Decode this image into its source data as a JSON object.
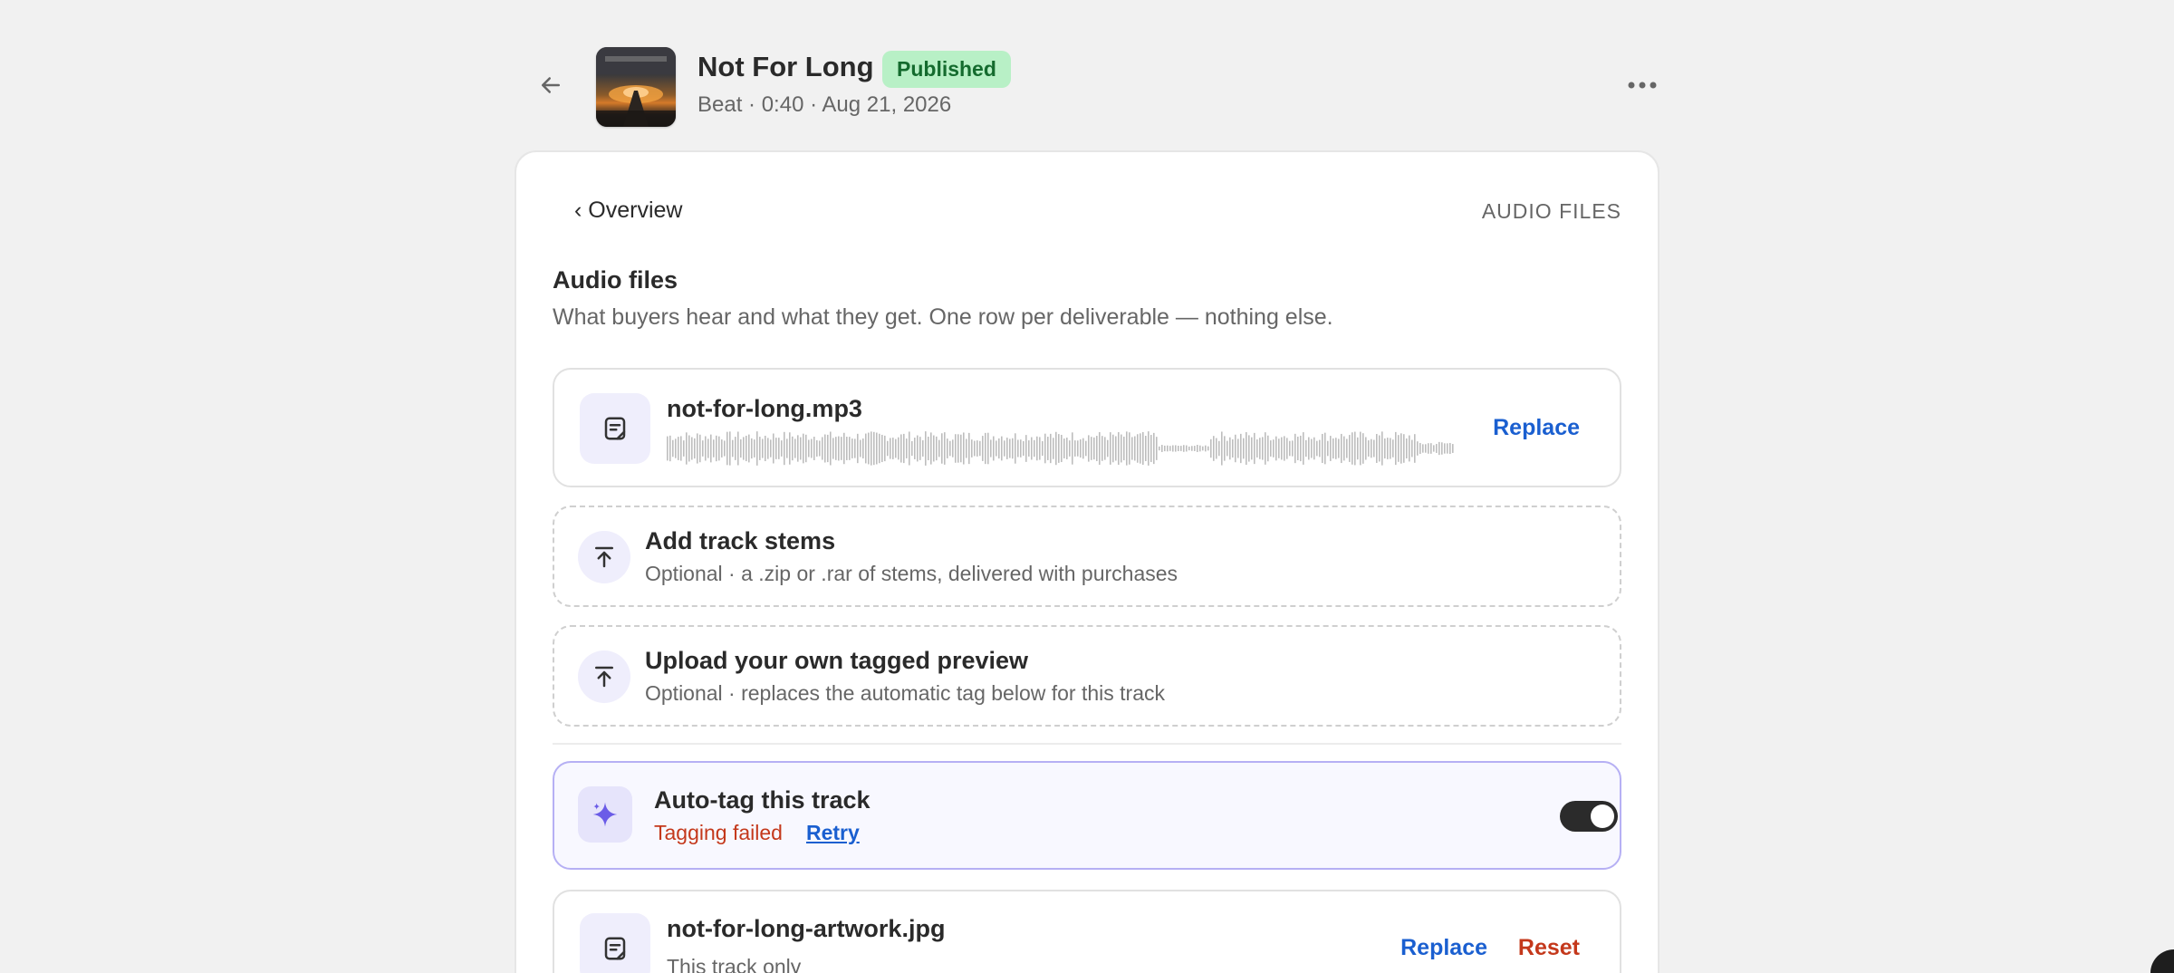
{
  "header": {
    "title": "Not For Long",
    "status_badge": "Published",
    "meta": "Beat · 0:40 · Aug 21, 2026"
  },
  "card": {
    "back_link": "‹ Overview",
    "section_tag": "AUDIO FILES",
    "title": "Audio files",
    "subtitle": "What buyers hear and what they get. One row per deliverable — nothing else."
  },
  "main_file": {
    "filename": "not-for-long.mp3",
    "replace_label": "Replace"
  },
  "stems": {
    "title": "Add track stems",
    "subtitle": "Optional · a .zip or .rar of stems, delivered with purchases"
  },
  "tagged_preview": {
    "title": "Upload your own tagged preview",
    "subtitle": "Optional · replaces the automatic tag below for this track"
  },
  "autotag": {
    "title": "Auto-tag this track",
    "status": "Tagging failed",
    "retry_label": "Retry",
    "enabled": true
  },
  "artwork_file": {
    "filename": "not-for-long-artwork.jpg",
    "subtitle": "This track only",
    "replace_label": "Replace",
    "reset_label": "Reset"
  },
  "colors": {
    "accent": "#6b5ce7",
    "link": "#1a5fd0",
    "danger": "#c4381b",
    "badge_bg": "#b8f0c6",
    "badge_text": "#146b2e"
  }
}
